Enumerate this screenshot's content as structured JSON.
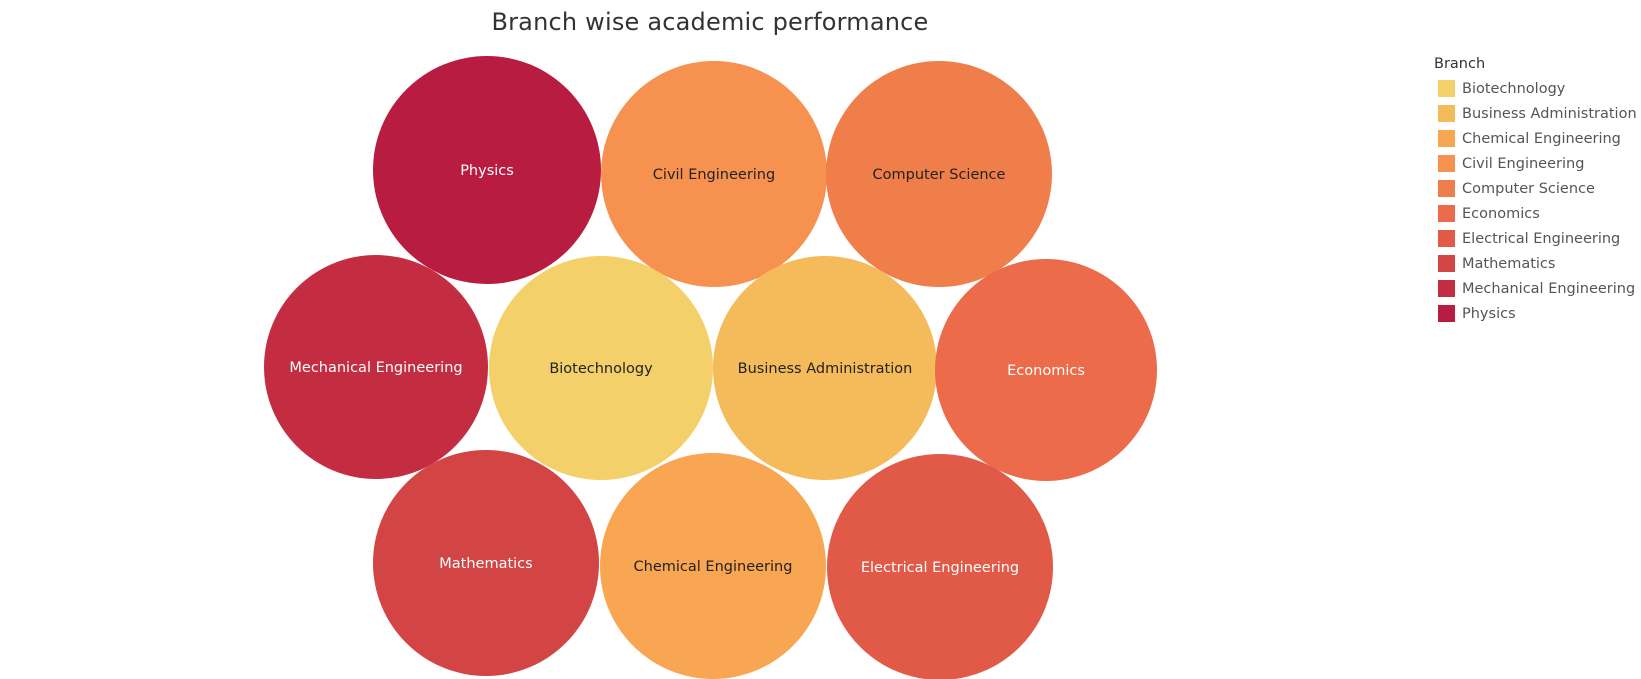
{
  "chart_data": {
    "type": "packed-bubble",
    "title": "Branch wise academic performance",
    "legend": {
      "title": "Branch",
      "placement": "right"
    },
    "categories": [
      "Biotechnology",
      "Business Administration",
      "Chemical Engineering",
      "Civil Engineering",
      "Computer Science",
      "Economics",
      "Electrical Engineering",
      "Mathematics",
      "Mechanical Engineering",
      "Physics"
    ],
    "bubbles": [
      {
        "label": "Physics",
        "color": "#b81c40",
        "text_color": "#ffffff"
      },
      {
        "label": "Civil Engineering",
        "color": "#f79150",
        "text_color": "#222222"
      },
      {
        "label": "Computer Science",
        "color": "#f07e4a",
        "text_color": "#222222"
      },
      {
        "label": "Mechanical Engineering",
        "color": "#c42d41",
        "text_color": "#ffffff"
      },
      {
        "label": "Biotechnology",
        "color": "#f3d06a",
        "text_color": "#222222"
      },
      {
        "label": "Business Administration",
        "color": "#f5ba5a",
        "text_color": "#222222"
      },
      {
        "label": "Economics",
        "color": "#eb6b4a",
        "text_color": "#ffffff"
      },
      {
        "label": "Mathematics",
        "color": "#d34545",
        "text_color": "#ffffff"
      },
      {
        "label": "Chemical Engineering",
        "color": "#f8a651",
        "text_color": "#222222"
      },
      {
        "label": "Electrical Engineering",
        "color": "#e05a47",
        "text_color": "#ffffff"
      }
    ],
    "legend_colors": {
      "Biotechnology": "#f3d06a",
      "Business Administration": "#f5ba5a",
      "Chemical Engineering": "#f8a651",
      "Civil Engineering": "#f79150",
      "Computer Science": "#f07e4a",
      "Economics": "#eb6b4a",
      "Electrical Engineering": "#e05a47",
      "Mathematics": "#d34545",
      "Mechanical Engineering": "#c42d41",
      "Physics": "#b81c40"
    }
  }
}
